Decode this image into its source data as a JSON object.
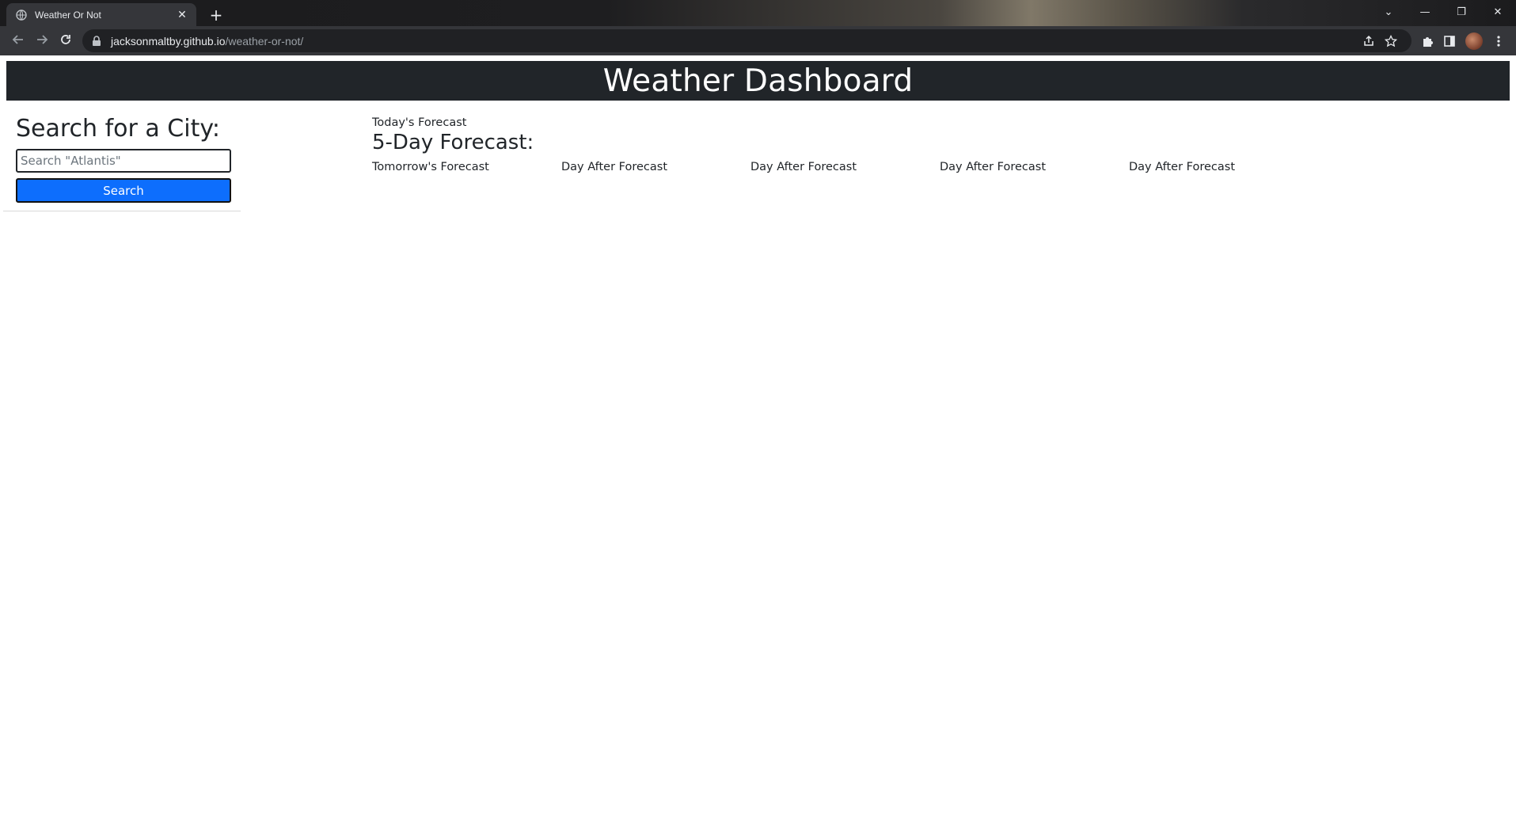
{
  "browser": {
    "tab_title": "Weather Or Not",
    "tab_close": "✕",
    "new_tab": "+",
    "url_host": "jacksonmaltby.github.io",
    "url_path": "/weather-or-not/",
    "window_controls": {
      "dropdown": "⌄",
      "minimize": "—",
      "restore": "❐",
      "close": "✕"
    }
  },
  "header": {
    "title": "Weather Dashboard",
    "background": "#212529"
  },
  "sidebar": {
    "heading": "Search for a City:",
    "search_placeholder": "Search \"Atlantis\"",
    "search_value": "",
    "search_button_label": "Search",
    "search_button_color": "#0d6efd"
  },
  "forecast": {
    "today_label": "Today's Forecast",
    "five_day_title": "5-Day Forecast:",
    "days": [
      {
        "label": "Tomorrow's Forecast"
      },
      {
        "label": "Day After Forecast"
      },
      {
        "label": "Day After Forecast"
      },
      {
        "label": "Day After Forecast"
      },
      {
        "label": "Day After Forecast"
      }
    ]
  }
}
